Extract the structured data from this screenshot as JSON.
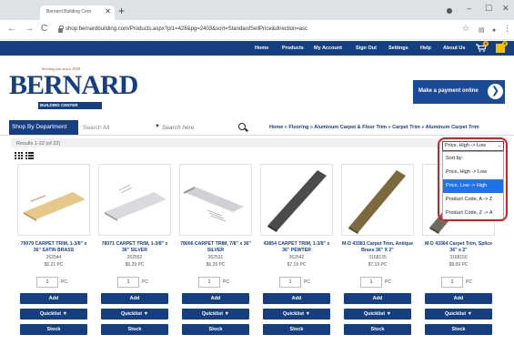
{
  "browser": {
    "tab_title": "Bernard Building Cent",
    "tab_close_icon": "close-icon",
    "new_tab": "+",
    "url": "shop.bernardbuilding.com/Products.aspx?pl1=428&pg=2403&sort=StandardSellPrice&direction=asc",
    "back_icon": "←",
    "forward_icon": "→",
    "reload_icon": "C",
    "star_icon": "☆",
    "min": "–",
    "max": "☐",
    "close": "✕"
  },
  "topnav": {
    "items": [
      "Home",
      "Products",
      "My Account",
      "Sign Out",
      "Settings",
      "Help",
      "About Us"
    ],
    "cart_badge": "0",
    "flag_badge": "0"
  },
  "header": {
    "logo_tag": "Serving you since 1938",
    "logo_word": "BERNARD",
    "logo_sub": "BUILDING CENTER",
    "pay_label": "Make a payment online",
    "pay_arrow": "❯"
  },
  "search": {
    "department_label": "Shop By Department",
    "scope": "Search All",
    "placeholder": "Search here",
    "breadcrumb": "Home » Flooring » Aluminum Carpet & Floor Trim » Carpet Trim » Aluminum Carpet Trim"
  },
  "results": {
    "text": "Results 1-22 (of 22)"
  },
  "sort": {
    "selected": "Price, High -> Low",
    "options": [
      "Sort by:",
      "Price, High -> Low",
      "Price, Low -> High",
      "Product Code, A -> Z",
      "Product Code, Z -> A"
    ],
    "highlighted_index": 2
  },
  "products": [
    {
      "name": "79079 CARPET TRIM, 1-3/8\" x 36\" SATIN BRASS",
      "sku": "262544",
      "price": "$5.21 PC",
      "qty": "1",
      "unit": "PC"
    },
    {
      "name": "78071 CARPET TRIM, 1-3/8\" x 36\" SILVER",
      "sku": "262552",
      "price": "$6.29 PC",
      "qty": "1",
      "unit": "PC"
    },
    {
      "name": "78006 CARPET TRIM, 7/8\" x 36\" SILVER",
      "sku": "262531",
      "price": "$6.29 PC",
      "qty": "1",
      "unit": "PC"
    },
    {
      "name": "43854 CARPET TRIM, 1-3/8\" x 36\" PEWTER",
      "sku": "262642",
      "price": "$7.19 PC",
      "qty": "1",
      "unit": "PC"
    },
    {
      "name": "M-D 43381 Carpet Trim, Antique Brass 36\" X 2\"",
      "sku": "3168135",
      "price": "$7.19 PC",
      "qty": "1",
      "unit": "PC"
    },
    {
      "name": "M-D 43364 Carpet Trim, Splice 36\" x 2\"",
      "sku": "3168150",
      "price": "$8.09 PC",
      "qty": "1",
      "unit": "PC"
    }
  ],
  "buttons": {
    "add": "Add",
    "quicklist": "Quicklist ▼",
    "stock": "Stock"
  },
  "colors": {
    "brand_blue": "#163f82",
    "highlight_red": "#e01b1b",
    "selected_option": "#1e73e8"
  }
}
